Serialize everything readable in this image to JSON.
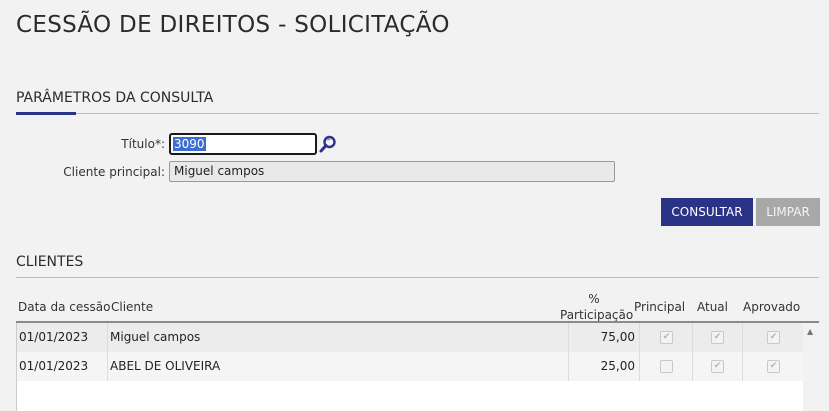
{
  "page": {
    "title": "CESSÃO DE DIREITOS - SOLICITAÇÃO"
  },
  "params": {
    "section_title": "PARÂMETROS DA CONSULTA",
    "titulo_label": "Título*:",
    "titulo_value": "3090",
    "cliente_label": "Cliente principal:",
    "cliente_value": "Miguel campos"
  },
  "buttons": {
    "consultar": "CONSULTAR",
    "limpar": "LIMPAR"
  },
  "clientes": {
    "section_title": "CLIENTES",
    "headers": {
      "data": "Data da cessão",
      "cliente": "Cliente",
      "participacao_pct": "%",
      "participacao": "Participação",
      "principal": "Principal",
      "atual": "Atual",
      "aprovado": "Aprovado"
    },
    "rows": [
      {
        "data": "01/01/2023",
        "cliente": "Miguel campos",
        "participacao": "75,00",
        "principal": true,
        "atual": true,
        "aprovado": true
      },
      {
        "data": "01/01/2023",
        "cliente": "ABEL DE OLIVEIRA",
        "participacao": "25,00",
        "principal": false,
        "atual": true,
        "aprovado": true
      }
    ]
  },
  "icons": {
    "search": "search-icon",
    "scroll_up": "scroll-up-arrow-icon"
  },
  "colors": {
    "primary": "#2b3386",
    "disabled": "#a8a8a8",
    "background": "#f2f2f2"
  }
}
